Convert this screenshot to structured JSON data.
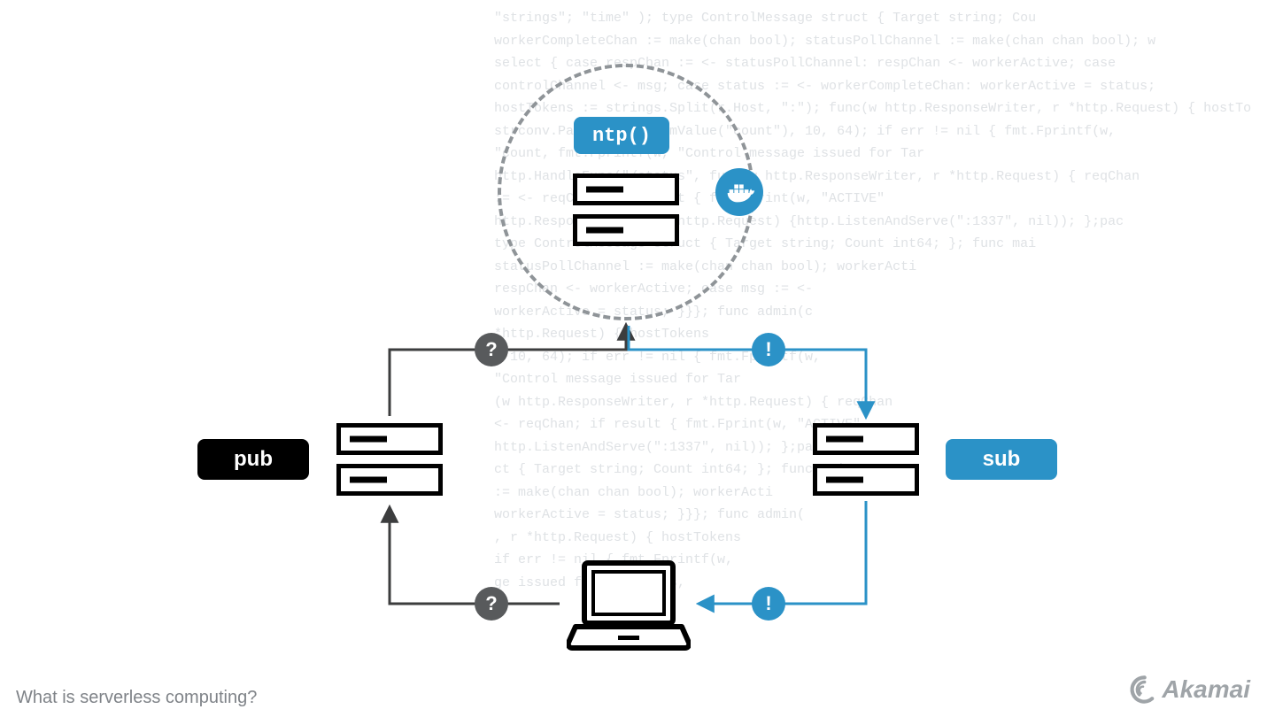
{
  "caption": "What is serverless computing?",
  "logo_text": "Akamai",
  "labels": {
    "ntp": "ntp()",
    "pub": "pub",
    "sub": "sub",
    "question": "?",
    "bang": "!"
  },
  "bg_code": "\"strings\"; \"time\" ); type ControlMessage struct { Target string; Cou\nworkerCompleteChan := make(chan bool); statusPollChannel := make(chan chan bool); w\nselect { case respChan := <- statusPollChannel: respChan <- workerActive; case \ncontrolChannel <- msg; case status := <- workerCompleteChan: workerActive = status; \nhostTokens := strings.Split(r.Host, \":\"); func(w http.ResponseWriter, r *http.Request) { hostTo\nstrconv.ParseInt(r.FormValue(\"count\"), 10, 64); if err != nil { fmt.Fprintf(w, \n\"count, fmt.Fprintf(w, \"Control message issued for Tar\nhttp.HandleFunc(\"/status\", func(w http.ResponseWriter, r *http.Request) { reqChan \n:= <- reqChan; if result { fmt.Fprint(w, \"ACTIVE\" \nhttp.ResponseWriter R *http.Request) {http.ListenAndServe(\":1337\", nil)); };pac\ntype ControlMessage struct { Target string; Count int64; }; func mai\nstatusPollChannel := make(chan chan bool); workerActi\nrespChan <- workerActive; case msg := <-\nworkerActive = status; }}}; func admin(c\n*http.Request) { hostTokens \n, 10, 64); if err != nil { fmt.Fprintf(w, \n\"Control message issued for Tar\n(w http.ResponseWriter, r *http.Request) { reqChan \n<- reqChan; if result { fmt.Fprint(w, \"ACTIVE\"\nhttp.ListenAndServe(\":1337\", nil)); };pac\nct { Target string; Count int64; }; func mai\n:= make(chan chan bool); workerActi\nworkerActive = status; }}}; func admin(\n, r *http.Request) { hostTokens \nif err != nil { fmt.Fprintf(w,\nge issued for Target %s,"
}
